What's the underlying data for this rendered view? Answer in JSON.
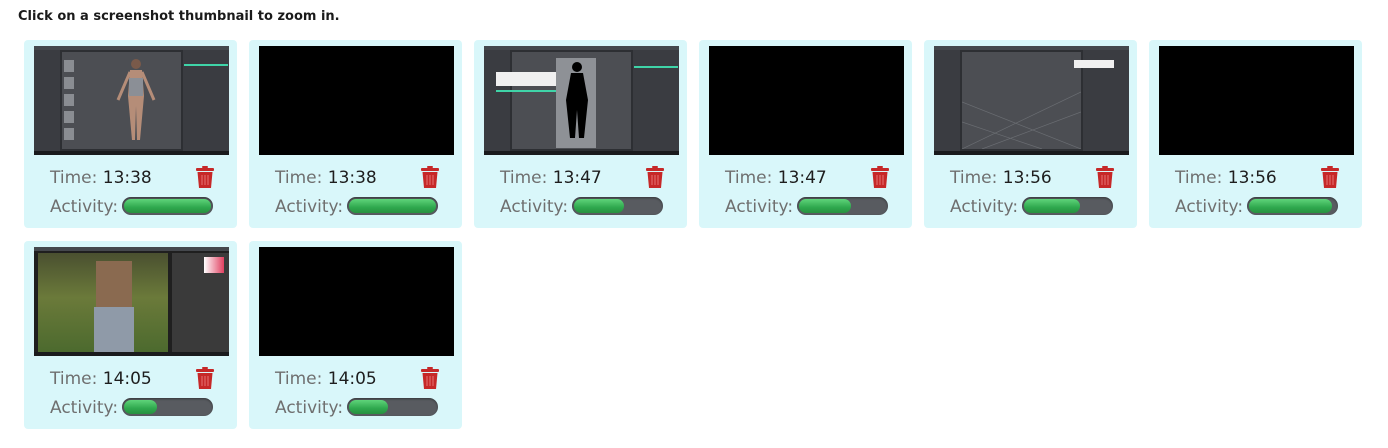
{
  "instruction": "Click on a screenshot thumbnail to zoom in.",
  "labels": {
    "time": "Time:",
    "activity": "Activity:"
  },
  "colors": {
    "card_bg": "#d9f7fa",
    "trash": "#c62828",
    "bar_fill": "#2fa84e",
    "bar_track": "#585b60"
  },
  "screenshots": [
    {
      "time": "13:38",
      "activity": 1.0,
      "thumbnail": "3d-figure-app"
    },
    {
      "time": "13:38",
      "activity": 1.0,
      "thumbnail": "black"
    },
    {
      "time": "13:47",
      "activity": 0.58,
      "thumbnail": "silhouette-app"
    },
    {
      "time": "13:47",
      "activity": 0.6,
      "thumbnail": "black"
    },
    {
      "time": "13:56",
      "activity": 0.64,
      "thumbnail": "empty-viewport-app"
    },
    {
      "time": "13:56",
      "activity": 0.95,
      "thumbnail": "black"
    },
    {
      "time": "14:05",
      "activity": 0.38,
      "thumbnail": "photo-editor-app"
    },
    {
      "time": "14:05",
      "activity": 0.45,
      "thumbnail": "black"
    }
  ]
}
